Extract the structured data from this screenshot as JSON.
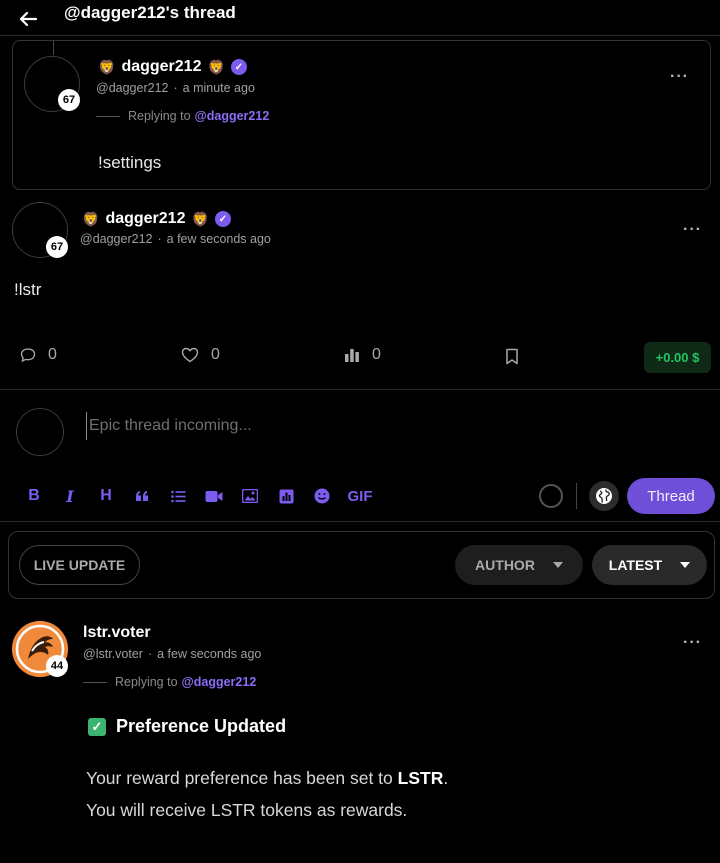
{
  "header": {
    "back_icon": "arrow-left-icon",
    "title": "@dagger212's thread"
  },
  "parent_post": {
    "level": "67",
    "name": "dagger212",
    "emoji": "🦁",
    "handle": "@dagger212",
    "time": "a minute ago",
    "replying_prefix": "Replying to",
    "replying_to": "@dagger212",
    "body": "!settings",
    "more": "···"
  },
  "main_post": {
    "level": "67",
    "name": "dagger212",
    "emoji": "🦁",
    "handle": "@dagger212",
    "time": "a few seconds ago",
    "body": "!lstr",
    "more": "···",
    "comments": "0",
    "likes": "0",
    "votes": "0",
    "tip": "+0.00 $"
  },
  "composer": {
    "placeholder": "Epic thread incoming...",
    "tools": [
      "B",
      "I",
      "H",
      "❝",
      "☰",
      "▶",
      "▣",
      "▥",
      "☺",
      "GIF"
    ],
    "submit_label": "Thread"
  },
  "filters": {
    "live": "LIVE UPDATE",
    "author": "AUTHOR",
    "latest": "LATEST"
  },
  "reply_post": {
    "level": "44",
    "name": "lstr.voter",
    "handle": "@lstr.voter",
    "time": "a few seconds ago",
    "replying_prefix": "Replying to",
    "replying_to": "@dagger212",
    "more": "···",
    "heading": "Preference Updated",
    "line1_prefix": "Your reward preference has been set to ",
    "line1_bold": "LSTR",
    "line1_suffix": ".",
    "line2": "You will receive LSTR tokens as rewards."
  },
  "colors": {
    "accent": "#7c5cf0",
    "tip_green": "#22c55e",
    "voter_orange": "#f08a3a"
  }
}
